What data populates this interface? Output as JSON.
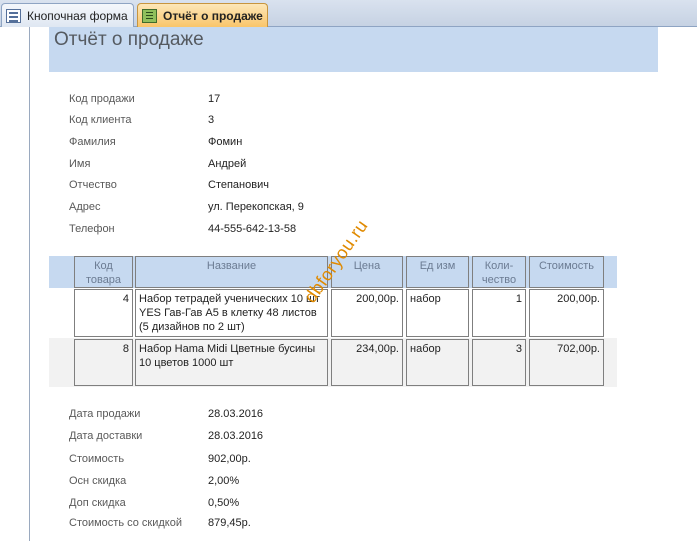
{
  "tabs": [
    {
      "label": "Кнопочная форма",
      "icon": "form-icon",
      "active": false
    },
    {
      "label": "Отчёт о продаже",
      "icon": "report-icon",
      "active": true
    }
  ],
  "report": {
    "title": "Отчёт о продаже",
    "header_fields": [
      {
        "label": "Код продажи",
        "value": "17"
      },
      {
        "label": "Код клиента",
        "value": "3"
      },
      {
        "label": "Фамилия",
        "value": "Фомин"
      },
      {
        "label": "Имя",
        "value": "Андрей"
      },
      {
        "label": "Отчество",
        "value": "Степанович"
      },
      {
        "label": "Адрес",
        "value": "ул. Перекопская, 9"
      },
      {
        "label": "Телефон",
        "value": "44-555-642-13-58"
      }
    ],
    "table": {
      "columns": [
        "Код товара",
        "Название",
        "Цена",
        "Ед изм",
        "Коли-чество",
        "Стоимость"
      ],
      "column_lines": [
        [
          "Код",
          "товара"
        ],
        [
          "Название"
        ],
        [
          "Цена"
        ],
        [
          "Ед изм"
        ],
        [
          "Коли-",
          "чество"
        ],
        [
          "Стоимость"
        ]
      ],
      "rows": [
        {
          "code": "4",
          "name": "Набор тетрадей ученических 10 шт YES Гав-Гав А5 в клетку 48 листов (5 дизайнов по 2 шт)",
          "price": "200,00р.",
          "unit": "набор",
          "qty": "1",
          "cost": "200,00р."
        },
        {
          "code": "8",
          "name": "Набор Hama Midi Цветные бусины 10 цветов 1000 шт",
          "price": "234,00р.",
          "unit": "набор",
          "qty": "3",
          "cost": "702,00р."
        }
      ]
    },
    "footer_fields": [
      {
        "label": "Дата продажи",
        "value": "28.03.2016"
      },
      {
        "label": "Дата доставки",
        "value": "28.03.2016"
      },
      {
        "label": "Стоимость",
        "value": "902,00р."
      },
      {
        "label": "Осн скидка",
        "value": "2,00%"
      },
      {
        "label": "Доп скидка",
        "value": "0,50%"
      },
      {
        "label": "Стоимость со скидкой",
        "value": "879,45р."
      }
    ]
  },
  "watermark": "dbforyou.ru",
  "colors": {
    "title_band": "#c6d9f0",
    "active_tab": "#f9c56a",
    "watermark": "#e08a00"
  }
}
